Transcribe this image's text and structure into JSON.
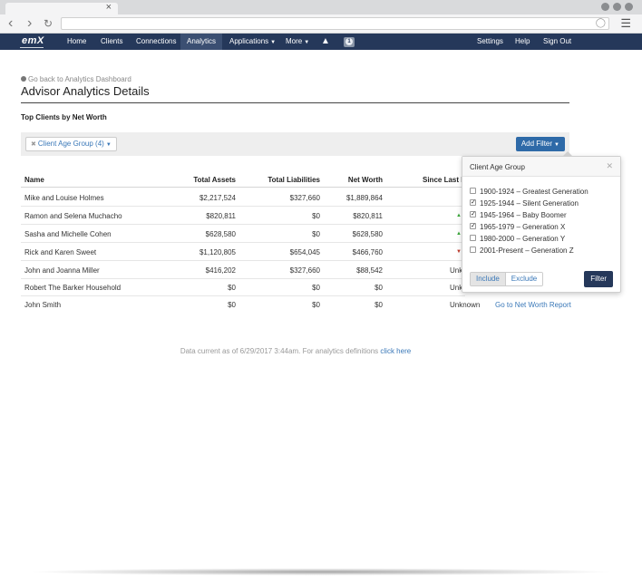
{
  "browser": {
    "tab_close": "×"
  },
  "nav": {
    "logo": "emX",
    "items": [
      "Home",
      "Clients",
      "Connections",
      "Analytics",
      "Applications",
      "More"
    ],
    "right": [
      "Settings",
      "Help",
      "Sign Out"
    ],
    "msg_count": "1"
  },
  "page": {
    "back_link": "Go back to Analytics Dashboard",
    "title": "Advisor Analytics Details",
    "section": "Top Clients by Net Worth"
  },
  "filter": {
    "chip": "Client Age Group (4)",
    "add_filter": "Add Filter"
  },
  "table": {
    "headers": [
      "Name",
      "Total Assets",
      "Total Liabilities",
      "Net Worth",
      "Since Last M"
    ],
    "rows": [
      {
        "name": "Mike and Louise Holmes",
        "assets": "$2,217,524",
        "liabilities": "$327,660",
        "net": "$1,889,864",
        "since": ""
      },
      {
        "name": "Ramon and Selena Muchacho",
        "assets": "$820,811",
        "liabilities": "$0",
        "net": "$820,811",
        "since": "up"
      },
      {
        "name": "Sasha and Michelle Cohen",
        "assets": "$628,580",
        "liabilities": "$0",
        "net": "$628,580",
        "since": "up"
      },
      {
        "name": "Rick and Karen Sweet",
        "assets": "$1,120,805",
        "liabilities": "$654,045",
        "net": "$466,760",
        "since": "down"
      },
      {
        "name": "John and Joanna Miller",
        "assets": "$416,202",
        "liabilities": "$327,660",
        "net": "$88,542",
        "since": "Unknown"
      },
      {
        "name": "Robert The Barker Household",
        "assets": "$0",
        "liabilities": "$0",
        "net": "$0",
        "since": "Unknown"
      },
      {
        "name": "John Smith",
        "assets": "$0",
        "liabilities": "$0",
        "net": "$0",
        "since": "Unknown",
        "link": "Go to Net Worth Report"
      }
    ]
  },
  "footer": {
    "text": "Data current as of 6/29/2017 3:44am. For analytics definitions",
    "link": "click here"
  },
  "popover": {
    "title": "Client Age Group",
    "options": [
      {
        "label": "1900-1924 – Greatest Generation",
        "checked": false
      },
      {
        "label": "1925-1944 – Silent Generation",
        "checked": true
      },
      {
        "label": "1945-1964 – Baby Boomer",
        "checked": true
      },
      {
        "label": "1965-1979 – Generation X",
        "checked": true
      },
      {
        "label": "1980-2000 – Generation Y",
        "checked": false
      },
      {
        "label": "2001-Present – Generation Z",
        "checked": false
      }
    ],
    "include": "Include",
    "exclude": "Exclude",
    "filter_button": "Filter"
  },
  "colors": {
    "nav_bg": "#25385a",
    "link": "#3a78b8",
    "up": "#3aa83a",
    "down": "#c0392b"
  }
}
